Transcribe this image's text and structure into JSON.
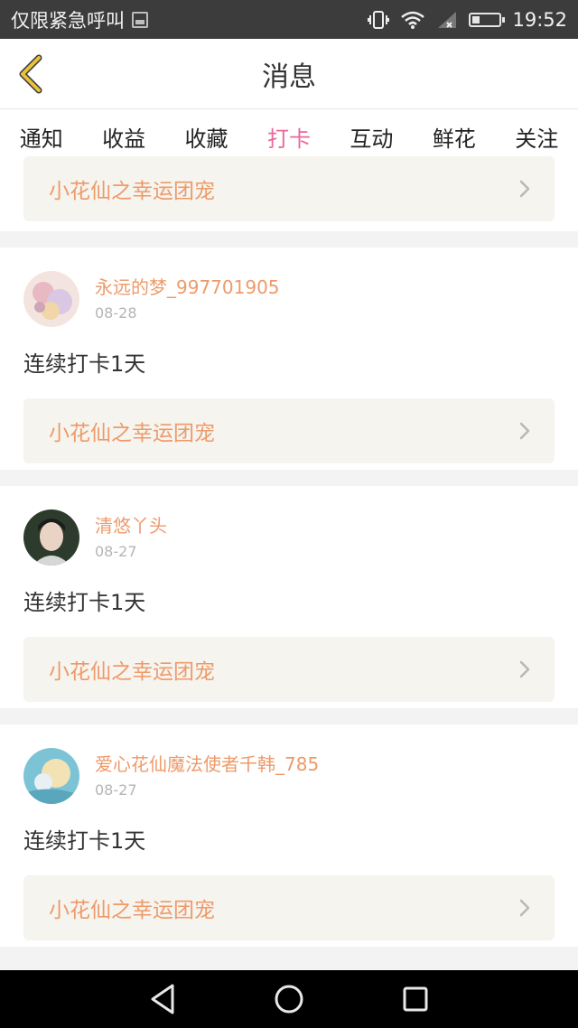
{
  "status_bar": {
    "carrier": "仅限紧急呼叫",
    "time": "19:52"
  },
  "header": {
    "title": "消息"
  },
  "tabs": [
    {
      "label": "通知",
      "active": false
    },
    {
      "label": "收益",
      "active": false
    },
    {
      "label": "收藏",
      "active": false
    },
    {
      "label": "打卡",
      "active": true
    },
    {
      "label": "互动",
      "active": false
    },
    {
      "label": "鲜花",
      "active": false
    },
    {
      "label": "关注",
      "active": false
    }
  ],
  "feed": {
    "partial_group": "小花仙之幸运团宠",
    "posts": [
      {
        "user": "永远的梦_997701905",
        "date": "08-28",
        "text": "连续打卡1天",
        "group": "小花仙之幸运团宠"
      },
      {
        "user": "清悠丫头",
        "date": "08-27",
        "text": "连续打卡1天",
        "group": "小花仙之幸运团宠"
      },
      {
        "user": "爱心花仙魔法使者千韩_785",
        "date": "08-27",
        "text": "连续打卡1天",
        "group": "小花仙之幸运团宠"
      }
    ]
  },
  "colors": {
    "accent": "#e9689c",
    "link": "#ee9a6a",
    "back_arrow": "#e8c23a"
  },
  "icons": {
    "back": "chevron-left-icon",
    "row": "chevron-right-icon"
  }
}
